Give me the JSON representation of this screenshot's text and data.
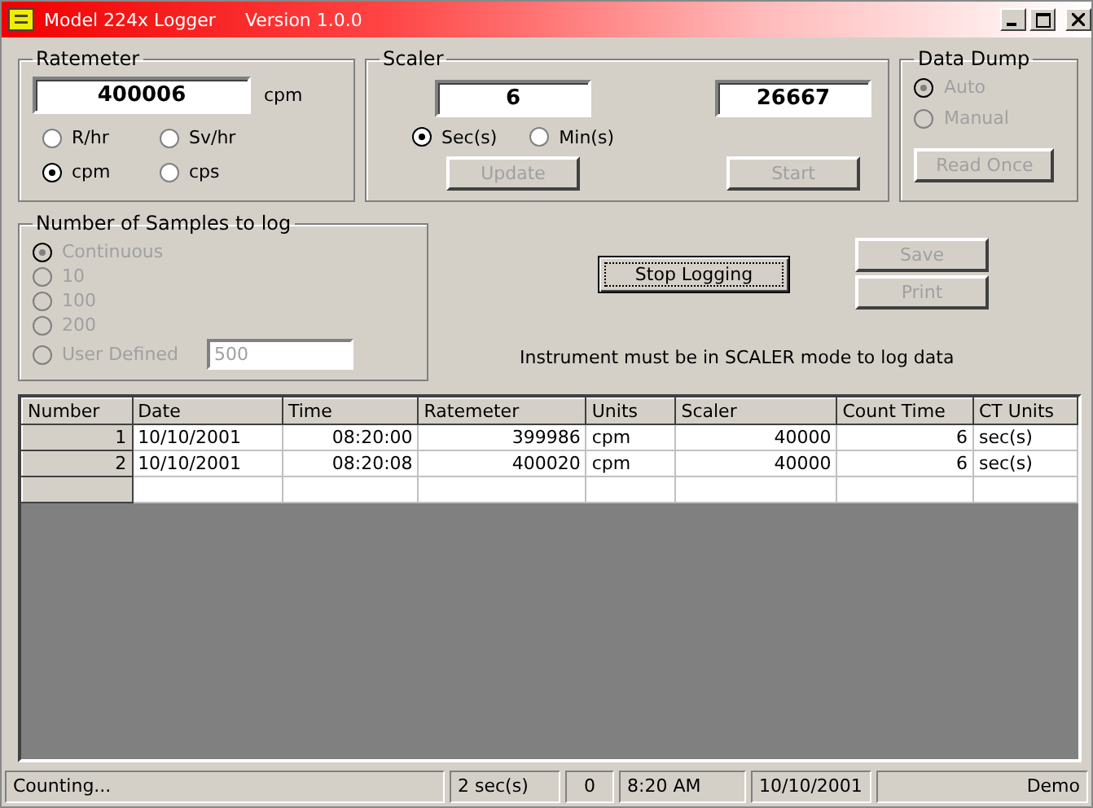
{
  "window": {
    "title": "Model 224x Logger",
    "version": "Version 1.0.0"
  },
  "ratemeter": {
    "label": "Ratemeter",
    "value": "400006",
    "unit": "cpm",
    "options": [
      {
        "label": "R/hr",
        "selected": false,
        "disabled": false
      },
      {
        "label": "Sv/hr",
        "selected": false,
        "disabled": false
      },
      {
        "label": "cpm",
        "selected": true,
        "disabled": false
      },
      {
        "label": "cps",
        "selected": false,
        "disabled": false
      }
    ]
  },
  "scaler": {
    "label": "Scaler",
    "count_time": "6",
    "count": "26667",
    "options": [
      {
        "label": "Sec(s)",
        "selected": true,
        "disabled": false
      },
      {
        "label": "Min(s)",
        "selected": false,
        "disabled": false
      }
    ],
    "buttons": [
      {
        "label": "Update",
        "disabled": true
      },
      {
        "label": "Start",
        "disabled": true
      }
    ]
  },
  "data_dump": {
    "label": "Data Dump",
    "options": [
      {
        "label": "Auto",
        "selected": true,
        "disabled": true
      },
      {
        "label": "Manual",
        "selected": false,
        "disabled": true
      }
    ],
    "button": {
      "label": "Read Once",
      "disabled": true
    }
  },
  "samples": {
    "label": "Number of Samples to log",
    "options": [
      {
        "label": "Continuous",
        "selected": true,
        "disabled": true
      },
      {
        "label": "10",
        "selected": false,
        "disabled": true
      },
      {
        "label": "100",
        "selected": false,
        "disabled": true
      },
      {
        "label": "200",
        "selected": false,
        "disabled": true
      },
      {
        "label": "User Defined",
        "selected": false,
        "disabled": true
      }
    ],
    "user_value": "500",
    "user_disabled": true
  },
  "logging_button": {
    "label": "Stop Logging",
    "disabled": false
  },
  "side_buttons": [
    {
      "label": "Save",
      "disabled": true
    },
    {
      "label": "Print",
      "disabled": true
    }
  ],
  "note": "Instrument must be in SCALER mode to log data",
  "table": {
    "columns": [
      "Number",
      "Date",
      "Time",
      "Ratemeter",
      "Units",
      "Scaler",
      "Count Time",
      "CT Units"
    ],
    "rows": [
      [
        "1",
        "10/10/2001",
        "08:20:00",
        "399986",
        "cpm",
        "40000",
        "6",
        "sec(s)"
      ],
      [
        "2",
        "10/10/2001",
        "08:20:08",
        "400020",
        "cpm",
        "40000",
        "6",
        "sec(s)"
      ]
    ]
  },
  "status_bar": [
    "Counting...",
    "2 sec(s)",
    "0",
    "8:20 AM",
    "10/10/2001",
    "Demo"
  ]
}
